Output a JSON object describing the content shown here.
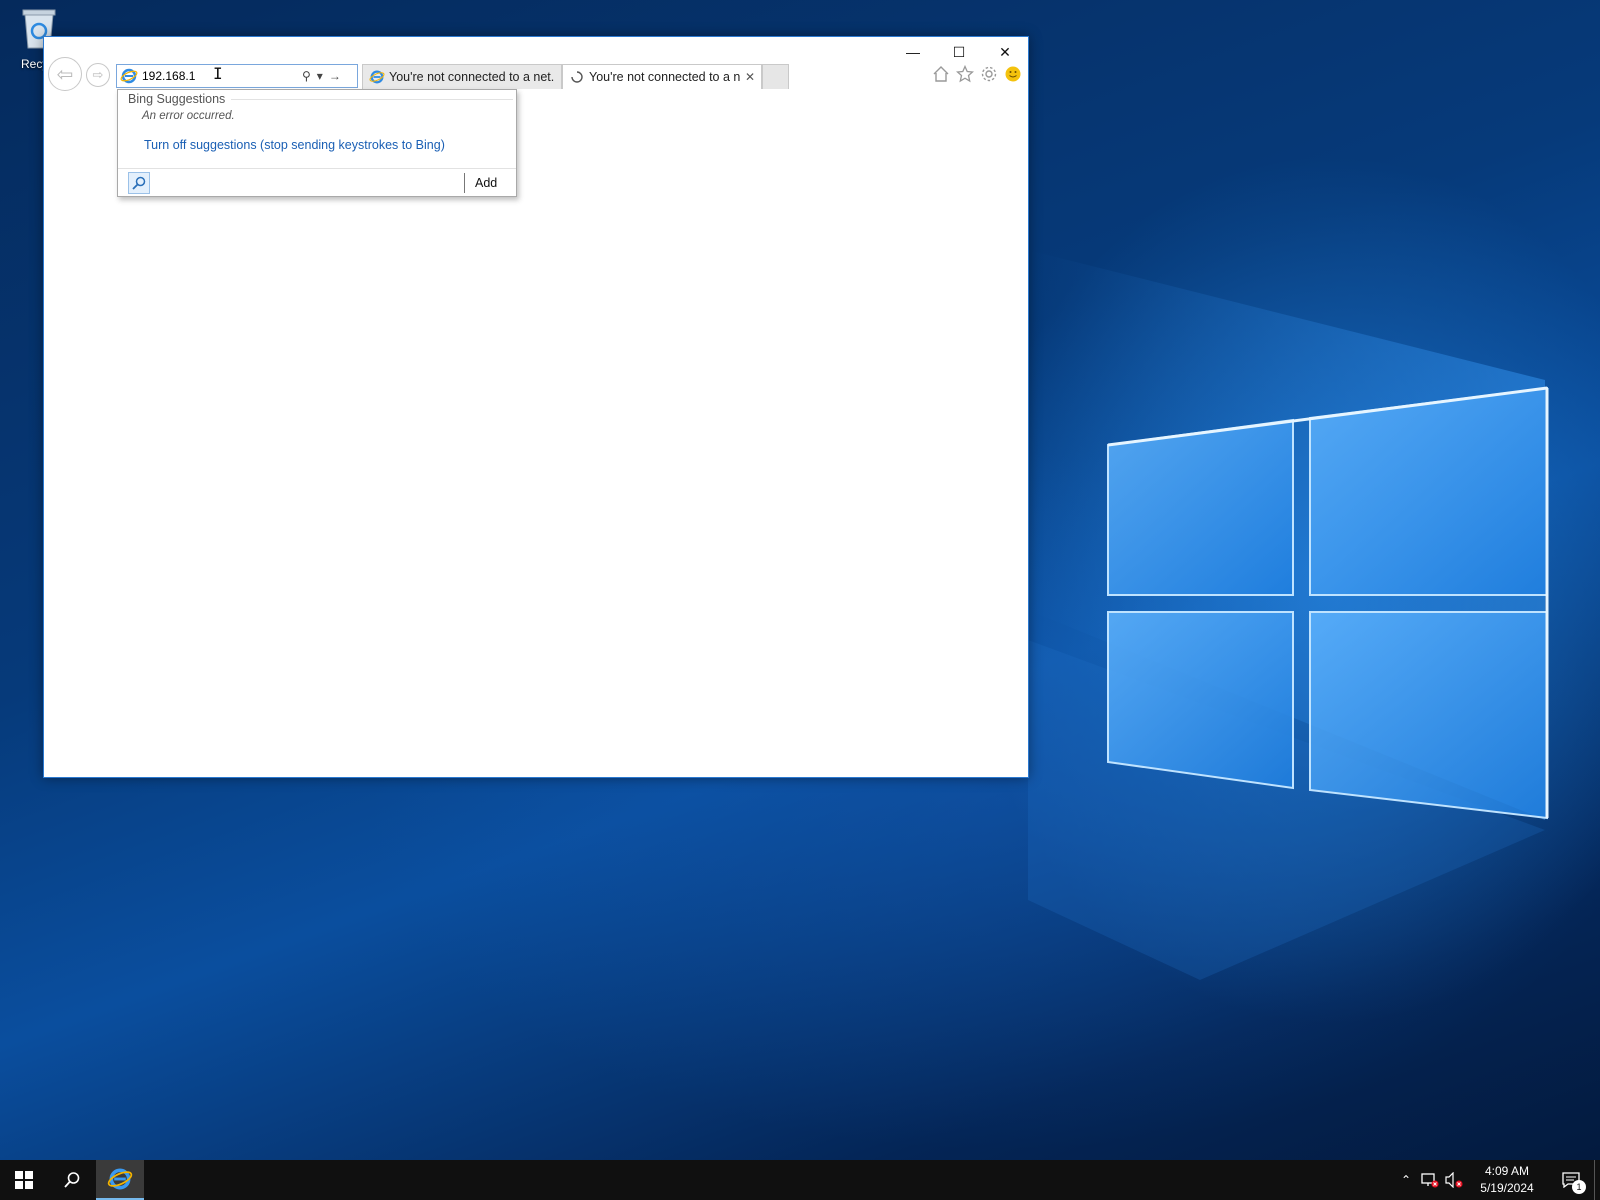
{
  "desktop": {
    "recycle_bin_label": "Recycl"
  },
  "browser": {
    "address_value": "192.168.1",
    "tabs": [
      {
        "label": "You're not connected to a net...",
        "icon": "ie-icon"
      },
      {
        "label": "You're not connected to a n...",
        "icon": "loading-icon"
      }
    ],
    "window_controls": {
      "minimize": "—",
      "maximize": "☐",
      "close": "✕"
    }
  },
  "suggestions": {
    "header": "Bing Suggestions",
    "error": "An error occurred.",
    "turn_off_link": "Turn off suggestions (stop sending keystrokes to Bing)",
    "add_label": "Add"
  },
  "taskbar": {
    "time": "4:09 AM",
    "date": "5/19/2024",
    "notification_count": "1"
  },
  "colors": {
    "accent": "#0078d7",
    "link": "#1a5fb4",
    "taskbar": "#101010"
  }
}
